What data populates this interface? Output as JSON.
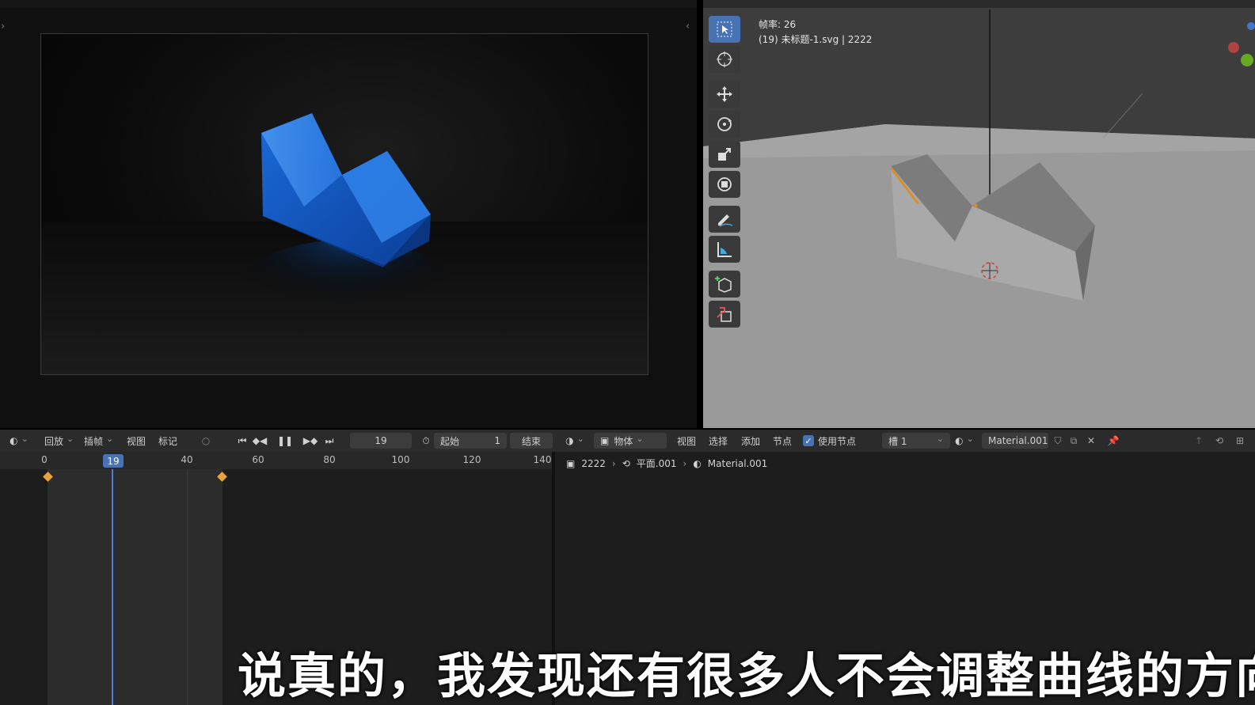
{
  "viewport": {
    "frame_rate": "帧率: 26",
    "object_info": "(19) 未标题-1.svg | 2222"
  },
  "toolbar_icons": [
    "select-box-icon",
    "cursor-icon",
    "move-icon",
    "rotate-icon",
    "scale-icon",
    "transform-icon",
    "annotate-icon",
    "measure-icon",
    "add-cube-icon",
    "extrude-icon"
  ],
  "timeline_header": {
    "playback": "回放",
    "keying": "插帧",
    "view": "视图",
    "marker": "标记",
    "current_frame": "19",
    "start_label": "起始",
    "start_value": "1",
    "end_label": "结束"
  },
  "timeline": {
    "ticks": [
      "0",
      "19",
      "40",
      "60",
      "80",
      "100",
      "120",
      "140"
    ],
    "current_frame_badge": "19"
  },
  "node_header": {
    "object_mode": "物体",
    "view": "视图",
    "select": "选择",
    "add": "添加",
    "node": "节点",
    "use_nodes": "使用节点",
    "slot": "槽 1",
    "material": "Material.001"
  },
  "breadcrumb": {
    "object": "2222",
    "mesh": "平面.001",
    "material": "Material.001"
  },
  "subtitle": "说真的，我发现还有很多人不会调整曲线的方向",
  "colors": {
    "accent_blue": "#4772b3",
    "keyframe": "#e8a43a",
    "object_blue": "#1f6fe0"
  }
}
